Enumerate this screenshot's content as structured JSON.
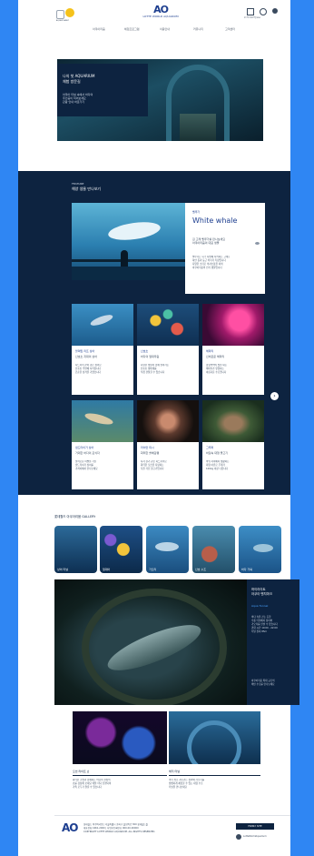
{
  "header": {
    "logo_mark": "AO",
    "logo_text": "LOTTE WORLD AQUARIUM",
    "left_caption": "AQUA PLANET",
    "icons": [
      "home-icon",
      "user-icon",
      "globe-icon"
    ],
    "icon_caption": "로그인  회원가입  ENG",
    "nav": [
      "아쿠아리움",
      "체험프로그램",
      "이용안내",
      "커뮤니티",
      "고객센터"
    ]
  },
  "hero": {
    "title_line1": "나의 첫 AQUARIUM",
    "title_line2": "체험 방문길",
    "body": [
      "아쿠아 터널 속에서 바다의",
      "주인공이 되어보세요",
      "관람 안내 바로가기"
    ]
  },
  "section1": {
    "eyebrow": "FEATURE",
    "title": "해양 생물 만나보기",
    "featured": {
      "kicker": "벨루가",
      "title": "White whale",
      "subtitle": [
        "흰 고래 벨루가를 만나보세요",
        "아쿠아리움의 대표 생물"
      ],
      "body": [
        "벨루가는 북극 지방에 서식하는 고래로",
        "하얀 몸과 둥근 머리가 특징입니다",
        "다양한 소리로 의사소통을 하며",
        "아쿠아리움의 인기 생물입니다"
      ]
    },
    "cards": [
      {
        "title": "블랙팁 리프 상어",
        "sub": "산호초 지대의 상어",
        "body": [
          "지느러미 끝이 검은 상어로",
          "산호초 주변에 서식합니다",
          "온순한 성격을 가졌습니다"
        ]
      },
      {
        "title": "산호초",
        "sub": "바다의 열대우림",
        "body": [
          "다양한 생물이 함께 살아가는",
          "산호초 생태계를",
          "직접 관찰할 수 있습니다"
        ]
      },
      {
        "title": "해파리",
        "sub": "신비로운 해파리",
        "body": [
          "형형색색의 빛을 내는",
          "해파리가 유영하는",
          "아름다운 수조입니다"
        ]
      },
      {
        "title": "샌드타이거 상어",
        "sub": "거대한 바다의 포식자",
        "body": [
          "날카로운 이빨을 가진",
          "샌드타이거 상어를",
          "가까이에서 만나보세요"
        ]
      },
      {
        "title": "라이언 피시",
        "sub": "화려한 쏠배감펭",
        "body": [
          "사자 갈기 같은 지느러미로",
          "화려한 모습을 자랑하는",
          "독을 가진 물고기입니다"
        ]
      },
      {
        "title": "그루퍼",
        "sub": "바닷속 대형 물고기",
        "body": [
          "바위 사이에서 생활하는",
          "대형 어류로 무게가",
          "100kg 이상 나갑니다"
        ]
      }
    ],
    "next_label": "›"
  },
  "section2": {
    "title": "롯데월드 아쿠아리움 GALLERY",
    "thumbs": [
      "상어 터널",
      "열대어",
      "가오리",
      "산호 수조",
      "바다 거북"
    ],
    "feature": {
      "title_line1": "하이라이트",
      "title_line2": "아쿠아 벤치마크",
      "tag": "Aqua Tunnel",
      "body": [
        "바다 속을 걷는 듯한",
        "수중 터널에서 상어와",
        "가오리를 만날 수 있습니다",
        "관람 시간 10:00 - 22:00",
        "터널 길이 85m"
      ],
      "foot": [
        "아쿠아리움 최대 규모의",
        "메인 수조를 만나보세요"
      ]
    },
    "bottom": [
      {
        "title": "오션 라이트 쇼",
        "body": [
          "화려한 조명과 함께하는 바닷속 환상의",
          "쇼를 감상해 보세요 매일 저녁 진행되며",
          "가족 모두가 즐길 수 있습니다"
        ]
      },
      {
        "title": "해저 터널",
        "body": [
          "머리 위로 지나가는 상어와 가오리를",
          "생생하게 체험할 수 있는 대형 수조",
          "터널을 만나보세요"
        ]
      }
    ]
  },
  "footer": {
    "logo_mark": "AO",
    "lines": [
      "롯데월드 아쿠아리움  |  서울특별시 송파구 올림픽로 300 롯데월드몰",
      "대표전화 1661-2000  |  사업자등록번호 000-00-00000",
      "COPYRIGHT LOTTE WORLD AQUARIUM. ALL RIGHTS RESERVED."
    ],
    "button": "FAMILY SITE",
    "sns_label": "LotteWorldAquarium"
  },
  "colors": {
    "page_bg": "#2f86f3",
    "navy": "#0d2340",
    "brand": "#1d3e8f",
    "accent_yellow": "#f5c21b"
  }
}
